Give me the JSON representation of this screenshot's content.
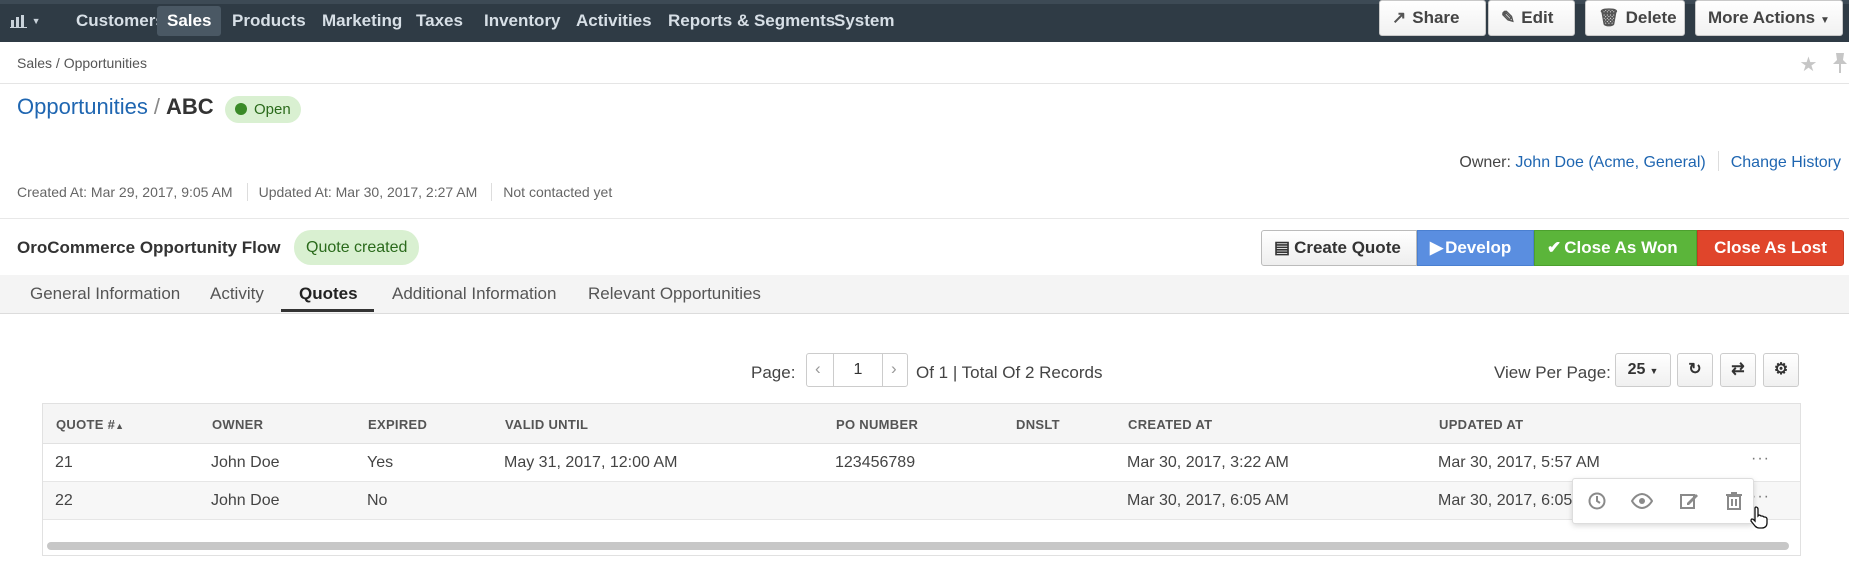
{
  "nav": {
    "dashboard_icon": "bar-chart-icon",
    "items": [
      "Customers",
      "Sales",
      "Products",
      "Marketing",
      "Taxes",
      "Inventory",
      "Activities",
      "Reports & Segments",
      "System"
    ],
    "active": "Sales"
  },
  "breadcrumb": "Sales / Opportunities",
  "header": {
    "entity_link": "Opportunities",
    "separator": "/",
    "record_name": "ABC",
    "status": "Open"
  },
  "actions": {
    "share": "Share",
    "edit": "Edit",
    "delete": "Delete",
    "more": "More Actions"
  },
  "owner": {
    "label": "Owner:",
    "value": "John Doe (Acme, General)",
    "change_history": "Change History"
  },
  "meta": {
    "created": "Created At: Mar 29, 2017, 9:05 AM",
    "updated": "Updated At: Mar 30, 2017, 2:27 AM",
    "contact": "Not contacted yet"
  },
  "flow": {
    "name": "OroCommerce Opportunity Flow",
    "step": "Quote created",
    "buttons": {
      "create_quote": "Create Quote",
      "develop": "Develop",
      "close_won": "Close As Won",
      "close_lost": "Close As Lost"
    }
  },
  "tabs": [
    "General Information",
    "Activity",
    "Quotes",
    "Additional Information",
    "Relevant Opportunities"
  ],
  "active_tab": "Quotes",
  "pager": {
    "label": "Page:",
    "current": "1",
    "total": "Of 1 | Total Of 2 Records",
    "view_per_page_label": "View Per Page:",
    "view_per_page": "25"
  },
  "grid": {
    "columns": [
      "QUOTE #",
      "OWNER",
      "EXPIRED",
      "VALID UNTIL",
      "PO NUMBER",
      "DNSLT",
      "CREATED AT",
      "UPDATED AT"
    ],
    "rows": [
      [
        "21",
        "John Doe",
        "Yes",
        "May 31, 2017, 12:00 AM",
        "123456789",
        "",
        "Mar 30, 2017, 3:22 AM",
        "Mar 30, 2017, 5:57 AM"
      ],
      [
        "22",
        "John Doe",
        "No",
        "",
        "",
        "",
        "Mar 30, 2017, 6:05 AM",
        "Mar 30, 2017, 6:05"
      ]
    ],
    "row_actions_icon": "ellipsis-icon",
    "popover_icons": [
      "history-icon",
      "view-icon",
      "edit-icon",
      "delete-icon"
    ]
  },
  "colors": {
    "nav_bg": "#2f3b45",
    "link": "#1f66b1",
    "develop": "#5a8ee0",
    "won": "#5bb53a",
    "lost": "#e0452b",
    "status_bg": "#d9f0d1"
  }
}
